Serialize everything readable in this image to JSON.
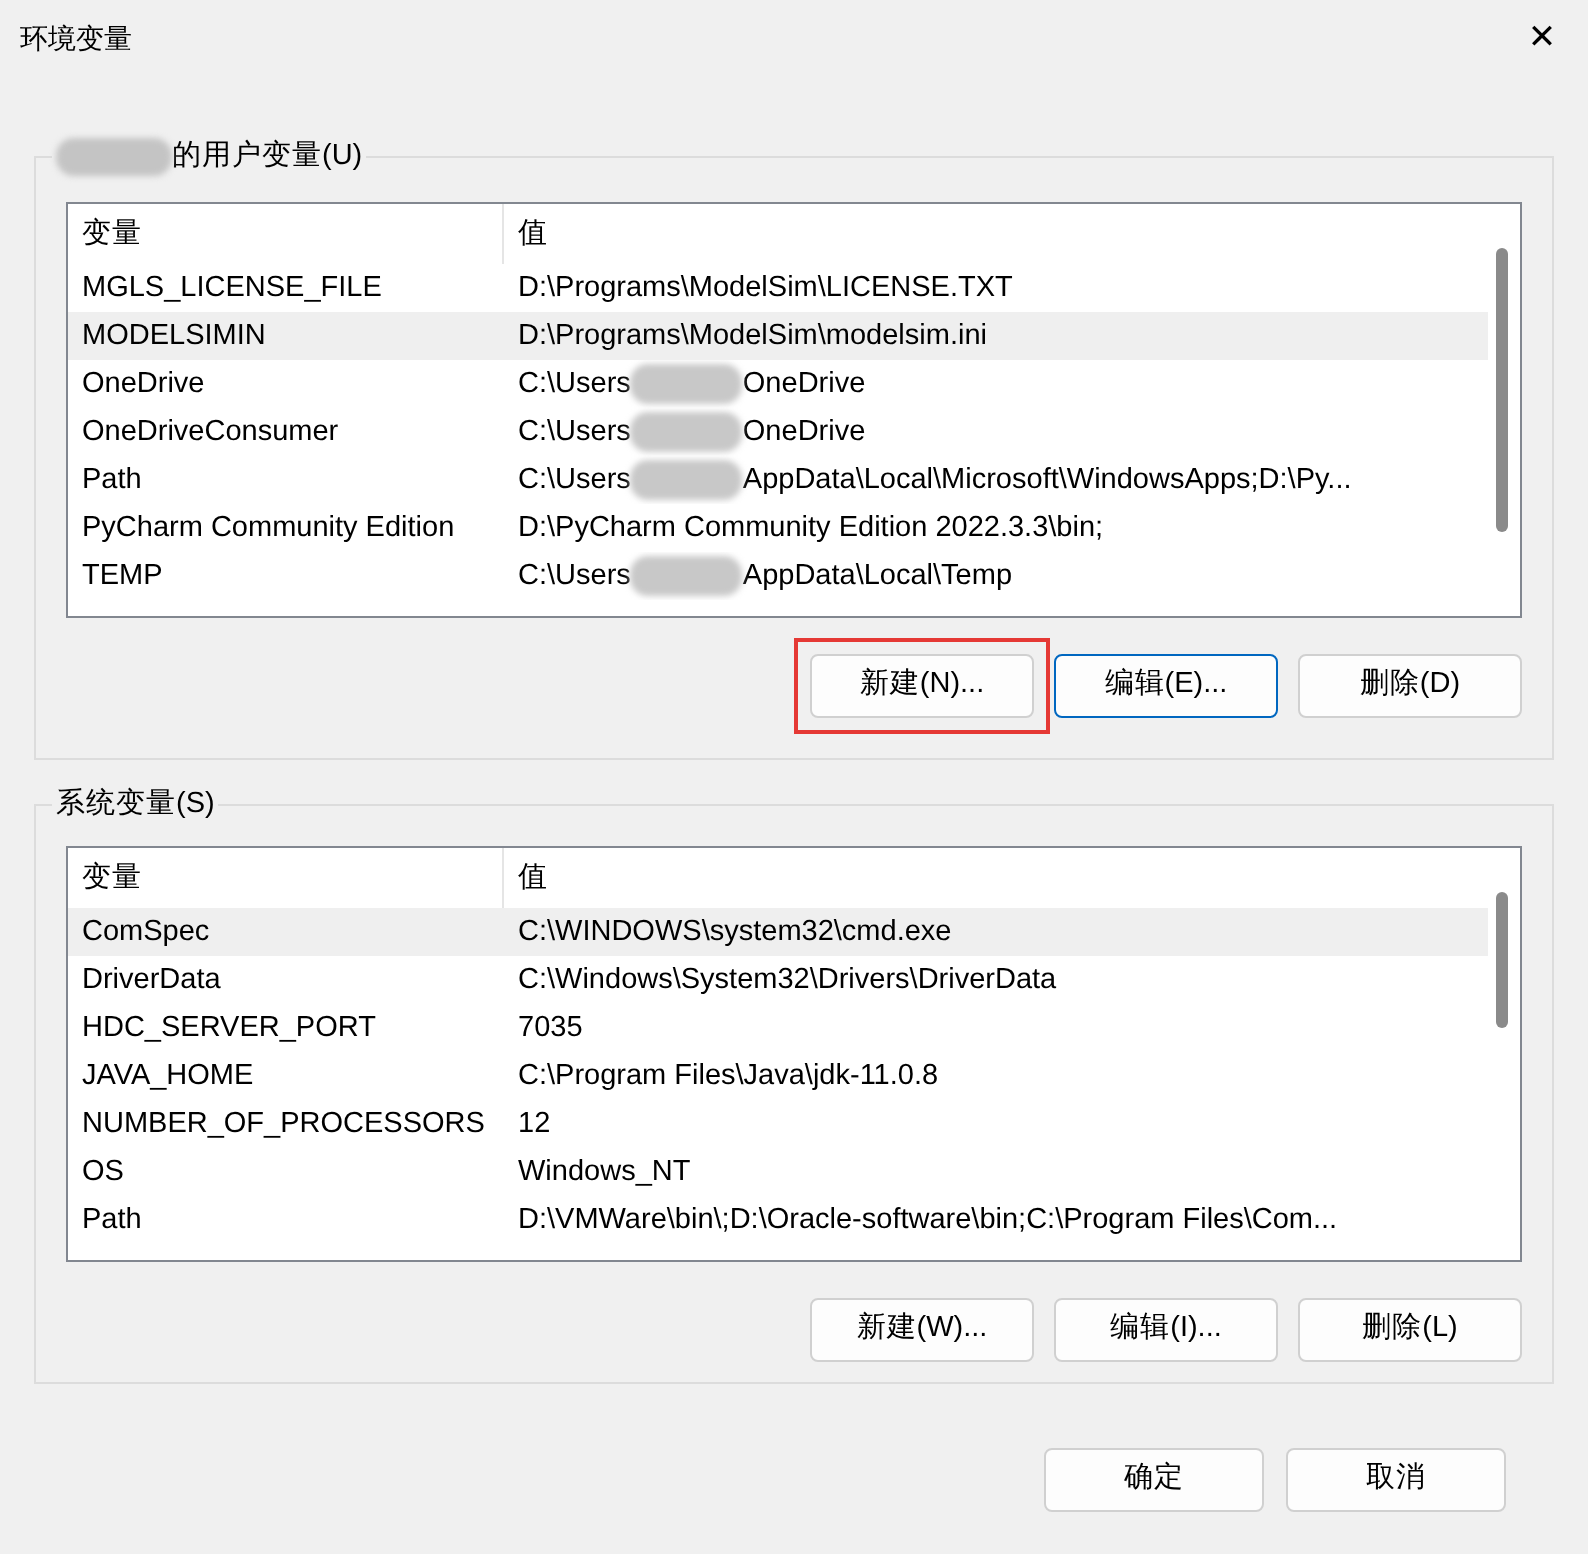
{
  "window": {
    "title": "环境变量",
    "close": "✕"
  },
  "user_vars": {
    "label": "的用户变量(U)",
    "label_redacted": true,
    "columns": [
      "变量",
      "值"
    ],
    "rows": [
      {
        "name": "MGLS_LICENSE_FILE",
        "value": "D:\\Programs\\ModelSim\\LICENSE.TXT",
        "selected": false
      },
      {
        "name": "MODELSIMIN",
        "value": "D:\\Programs\\ModelSim\\modelsim.ini",
        "selected": true
      },
      {
        "name": "OneDrive",
        "value": "C:\\Users",
        "value_after": "OneDrive",
        "redacted": true,
        "selected": false
      },
      {
        "name": "OneDriveConsumer",
        "value": "C:\\Users",
        "value_after": "OneDrive",
        "redacted": true,
        "selected": false
      },
      {
        "name": "Path",
        "value": "C:\\Users",
        "value_after": "AppData\\Local\\Microsoft\\WindowsApps;D:\\Py...",
        "redacted": true,
        "selected": false
      },
      {
        "name": "PyCharm Community Edition",
        "value": "D:\\PyCharm Community Edition 2022.3.3\\bin;",
        "selected": false
      },
      {
        "name": "TEMP",
        "value": "C:\\Users",
        "value_after": "AppData\\Local\\Temp",
        "redacted": true,
        "selected": false
      }
    ],
    "buttons": [
      {
        "label": "新建(N)...",
        "highlighted": true,
        "focused": false
      },
      {
        "label": "编辑(E)...",
        "highlighted": false,
        "focused": true
      },
      {
        "label": "删除(D)",
        "highlighted": false,
        "focused": false
      }
    ]
  },
  "system_vars": {
    "label": "系统变量(S)",
    "columns": [
      "变量",
      "值"
    ],
    "rows": [
      {
        "name": "ComSpec",
        "value": "C:\\WINDOWS\\system32\\cmd.exe",
        "selected": true
      },
      {
        "name": "DriverData",
        "value": "C:\\Windows\\System32\\Drivers\\DriverData",
        "selected": false
      },
      {
        "name": "HDC_SERVER_PORT",
        "value": "7035",
        "selected": false
      },
      {
        "name": "JAVA_HOME",
        "value": "C:\\Program Files\\Java\\jdk-11.0.8",
        "selected": false
      },
      {
        "name": "NUMBER_OF_PROCESSORS",
        "value": "12",
        "selected": false
      },
      {
        "name": "OS",
        "value": "Windows_NT",
        "selected": false
      },
      {
        "name": "Path",
        "value": "D:\\VMWare\\bin\\;D:\\Oracle-software\\bin;C:\\Program Files\\Com...",
        "selected": false
      }
    ],
    "buttons": [
      {
        "label": "新建(W)...",
        "highlighted": false,
        "focused": false
      },
      {
        "label": "编辑(I)...",
        "highlighted": false,
        "focused": false
      },
      {
        "label": "删除(L)",
        "highlighted": false,
        "focused": false
      }
    ]
  },
  "footer_buttons": [
    "确定",
    "取消"
  ]
}
